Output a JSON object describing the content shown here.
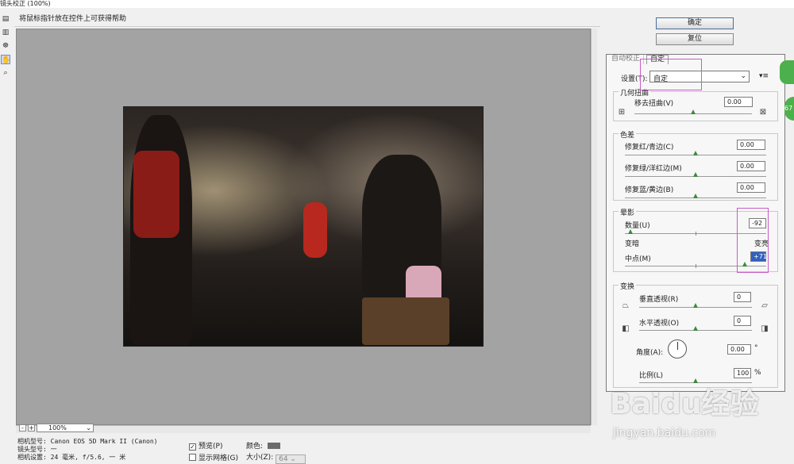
{
  "window": {
    "title": "镜头校正 (100%)"
  },
  "hint": "将鼠标指针放在控件上可获得帮助",
  "tools": [
    {
      "name": "remove-distortion-tool",
      "glyph": "▤"
    },
    {
      "name": "straighten-tool",
      "glyph": "▥"
    },
    {
      "name": "move-grid-tool",
      "glyph": "☸"
    },
    {
      "name": "hand-tool",
      "glyph": "✋"
    },
    {
      "name": "zoom-tool",
      "glyph": "⌕"
    }
  ],
  "buttons": {
    "ok": "确定",
    "reset": "复位"
  },
  "tabs": {
    "auto": "自动校正",
    "custom": "自定"
  },
  "settings": {
    "label": "设置(T):",
    "value": "自定",
    "menu_icon": "▾≡"
  },
  "geometric": {
    "title": "几何扭曲",
    "remove_distortion": {
      "label": "移去扭曲(V)",
      "value": "0.00",
      "level": 0.5
    }
  },
  "chromatic": {
    "title": "色差",
    "red_cyan": {
      "label": "修复红/青边(C)",
      "value": "0.00",
      "level": 0.5
    },
    "green_magenta": {
      "label": "修复绿/洋红边(M)",
      "value": "0.00",
      "level": 0.5
    },
    "blue_yellow": {
      "label": "修复蓝/黄边(B)",
      "value": "0.00",
      "level": 0.5
    }
  },
  "vignette": {
    "title": "晕影",
    "amount": {
      "label": "数量(U)",
      "value": "-92",
      "level": 0.04
    },
    "dark": "变暗",
    "light": "变亮",
    "midpoint": {
      "label": "中点(M)",
      "value": "+71",
      "level": 0.85
    }
  },
  "transform": {
    "title": "变换",
    "vertical": {
      "label": "垂直透视(R)",
      "value": "0",
      "level": 0.5
    },
    "horizontal": {
      "label": "水平透视(O)",
      "value": "0",
      "level": 0.5
    },
    "angle": {
      "label": "角度(A):",
      "value": "0.00",
      "unit": "°"
    },
    "scale": {
      "label": "比例(L)",
      "value": "100",
      "unit": "%",
      "level": 0.5
    }
  },
  "zoom": {
    "value": "100%",
    "minus": "-",
    "plus": "+"
  },
  "camera_info": {
    "model": "相机型号: Canon EOS 5D Mark II (Canon)",
    "lens": "镜头型号: 一",
    "settings": "相机设置: 24 毫米, f/5.6, 一 米"
  },
  "options": {
    "preview": {
      "label": "预览(P)",
      "checked": true
    },
    "show_grid": {
      "label": "显示网格(G)",
      "checked": false
    },
    "color_label": "颜色:",
    "size_label": "大小(Z):",
    "size_value": "64"
  },
  "watermark": {
    "brand": "Baidu经验",
    "url": "jingyan.baidu.com"
  },
  "side_badge": "67"
}
